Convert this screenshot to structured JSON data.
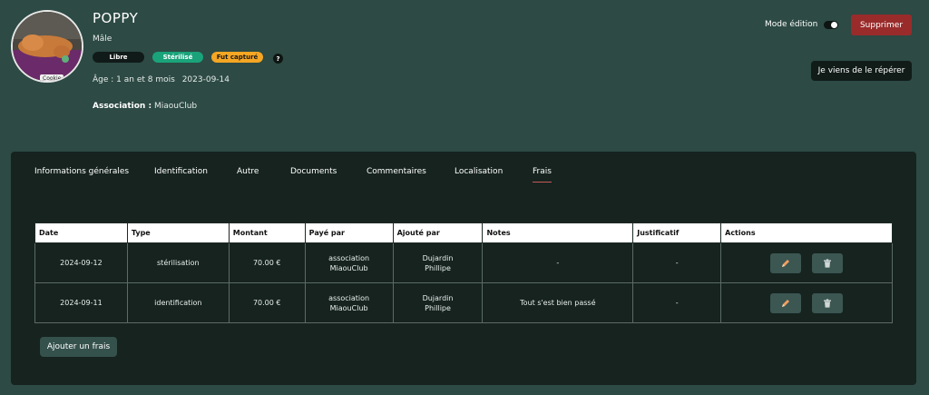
{
  "cat": {
    "name": "POPPY",
    "sex": "Mâle",
    "avatar_caption": "Cookie",
    "badges": {
      "free": "Libre",
      "sterilized": "Stérilisé",
      "captured": "Fut capturé"
    },
    "help": "?",
    "age_label": "Âge : 1 an et 8 mois",
    "birth_date": "2023-09-14",
    "association_label": "Association :",
    "association_value": "MiaouClub"
  },
  "header_actions": {
    "edit_mode_label": "Mode édition",
    "delete_label": "Supprimer",
    "spotted_label": "Je viens de le répérer"
  },
  "tabs": [
    {
      "label": "Informations générales"
    },
    {
      "label": "Identification"
    },
    {
      "label": "Autre"
    },
    {
      "label": "Documents"
    },
    {
      "label": "Commentaires"
    },
    {
      "label": "Localisation"
    },
    {
      "label": "Frais",
      "active": true
    }
  ],
  "fees_table": {
    "headers": [
      "Date",
      "Type",
      "Montant",
      "Payé par",
      "Ajouté par",
      "Notes",
      "Justificatif",
      "Actions"
    ],
    "rows": [
      {
        "date": "2024-09-12",
        "type": "stérilisation",
        "amount": "70.00 €",
        "paid_by_1": "association",
        "paid_by_2": "MiaouClub",
        "added_by_1": "Dujardin",
        "added_by_2": "Phillipe",
        "notes": "-",
        "receipt": "-"
      },
      {
        "date": "2024-09-11",
        "type": "identification",
        "amount": "70.00 €",
        "paid_by_1": "association",
        "paid_by_2": "MiaouClub",
        "added_by_1": "Dujardin",
        "added_by_2": "Phillipe",
        "notes": "Tout s'est bien passé",
        "receipt": "-"
      }
    ]
  },
  "add_fee_label": "Ajouter un frais",
  "icons": {
    "edit": "pencil-icon",
    "delete": "trash-icon"
  },
  "colors": {
    "background": "#2d4a44",
    "panel": "#16231f",
    "delete_red": "#9a2b2b",
    "sterilized_green": "#1aa37a",
    "captured_orange": "#f5a623"
  }
}
